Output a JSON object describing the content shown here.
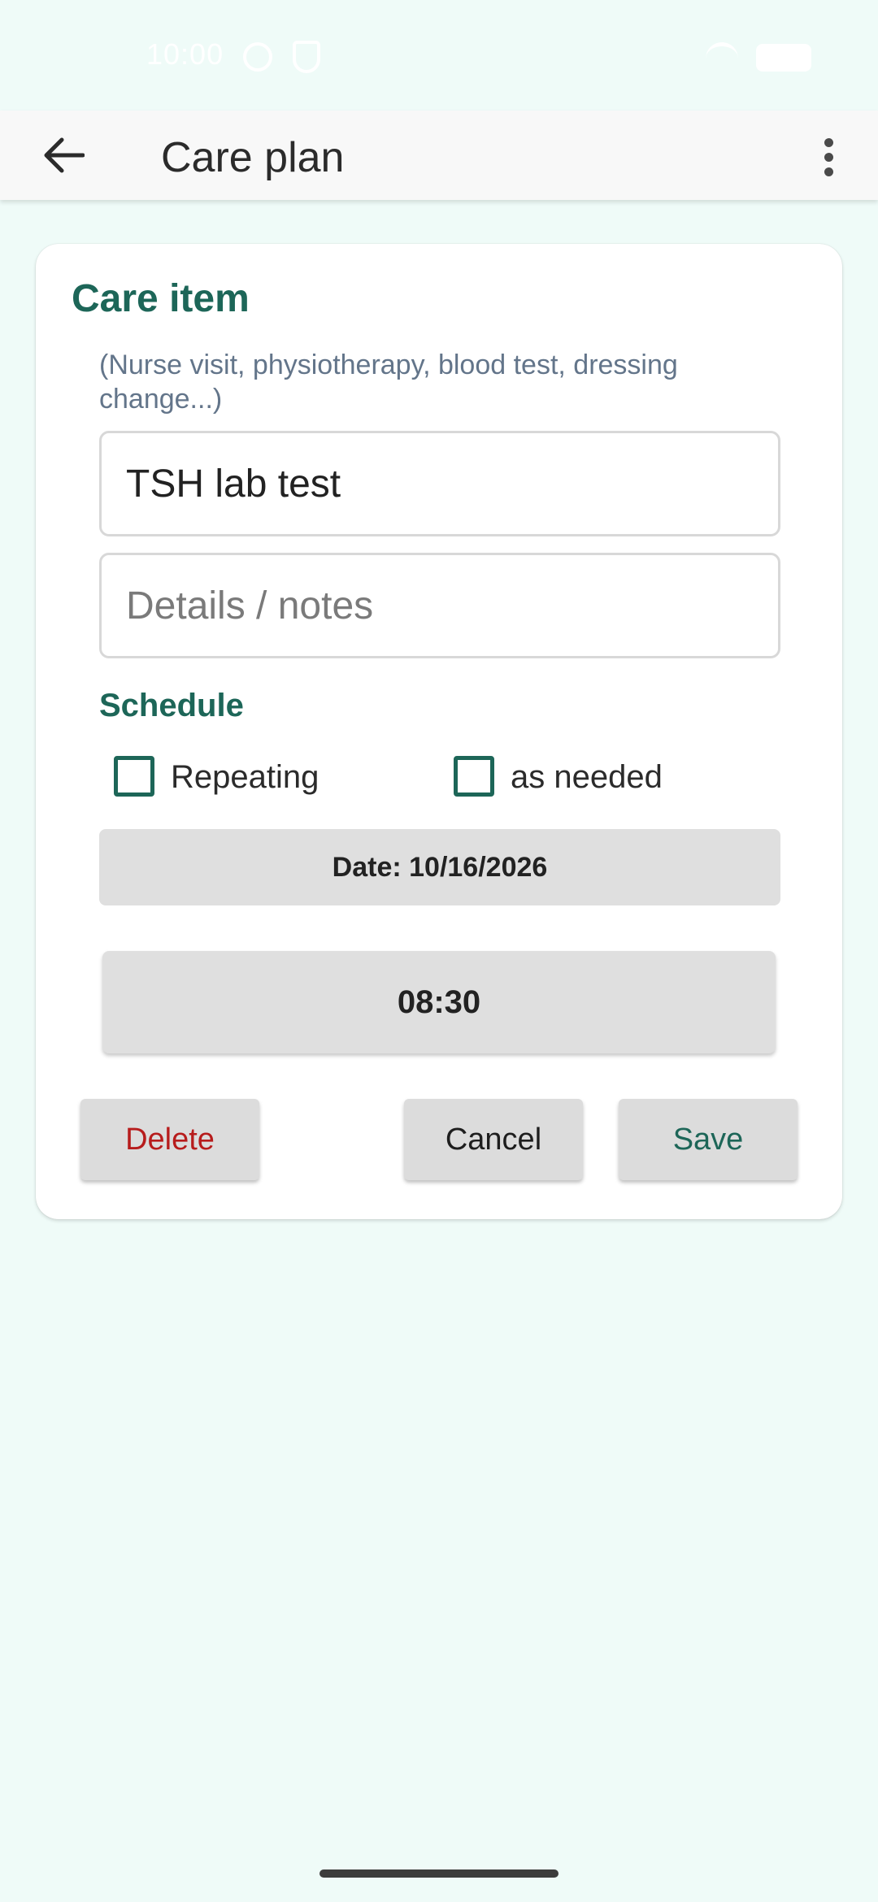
{
  "status_bar": {
    "time": "10:00",
    "icons": [
      "info-icon",
      "shield-icon",
      "wifi-icon",
      "battery-icon"
    ]
  },
  "app_bar": {
    "title": "Care plan",
    "back_icon": "arrow-back-icon",
    "menu_icon": "more-vert-icon"
  },
  "form": {
    "title": "Care item",
    "hint": "(Nurse visit, physiotherapy, blood test, dressing change...)",
    "name_value": "TSH lab test",
    "notes_value": "",
    "notes_placeholder": "Details / notes",
    "schedule_title": "Schedule",
    "repeating_label": "Repeating",
    "repeating_checked": false,
    "as_needed_label": "as needed",
    "as_needed_checked": false,
    "date_label": "Date: 10/16/2026",
    "time_label": "08:30"
  },
  "actions": {
    "delete": "Delete",
    "cancel": "Cancel",
    "save": "Save"
  },
  "colors": {
    "background": "#effbf8",
    "accent": "#1d6658",
    "danger": "#b71c1c",
    "hint": "#63758a"
  }
}
